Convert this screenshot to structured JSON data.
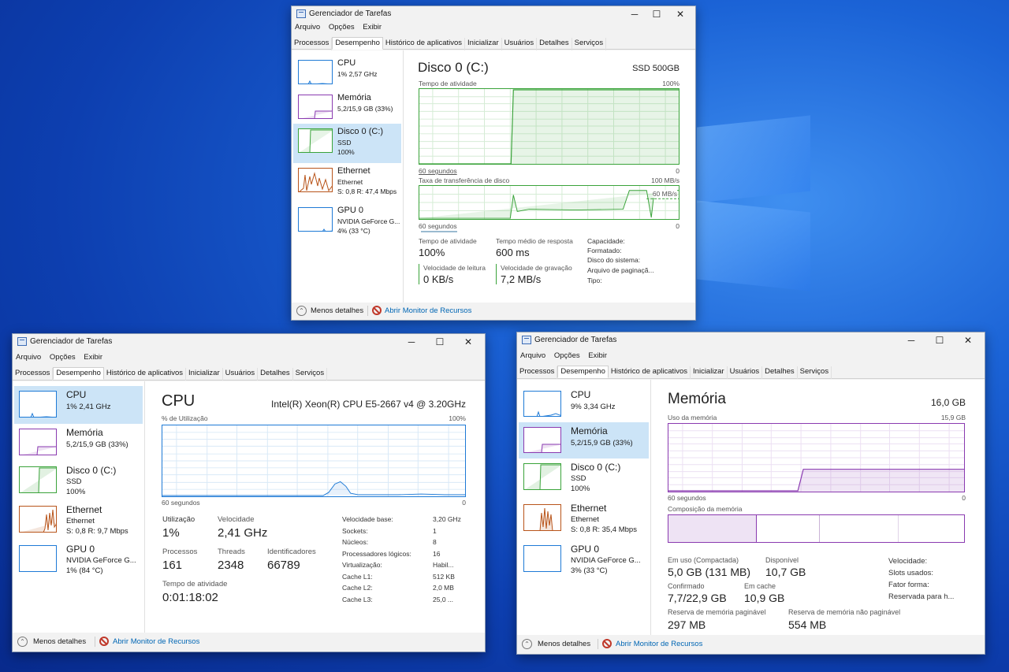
{
  "desktop": {
    "logo": "windows-logo"
  },
  "app": {
    "title": "Gerenciador de Tarefas",
    "menu": [
      "Arquivo",
      "Opções",
      "Exibir"
    ],
    "tabs": [
      "Processos",
      "Desempenho",
      "Histórico de aplicativos",
      "Inicializar",
      "Usuários",
      "Detalhes",
      "Serviços"
    ],
    "active_tab": "Desempenho",
    "footer": {
      "less_details": "Menos detalhes",
      "resource_monitor": "Abrir Monitor de Recursos"
    },
    "window_buttons": [
      "─",
      "☐",
      "✕"
    ]
  },
  "disk_window": {
    "sidebar": [
      {
        "name": "CPU",
        "line1": "1% 2,57 GHz",
        "line2": "",
        "color": "#1e7ad6"
      },
      {
        "name": "Memória",
        "line1": "5,2/15,9 GB (33%)",
        "line2": "",
        "color": "#8a3ab0"
      },
      {
        "name": "Disco 0 (C:)",
        "line1": "SSD",
        "line2": "100%",
        "color": "#3aa33a",
        "selected": true
      },
      {
        "name": "Ethernet",
        "line1": "Ethernet",
        "line2": "S: 0,8 R: 47,4 Mbps",
        "color": "#b8541a"
      },
      {
        "name": "GPU 0",
        "line1": "NVIDIA GeForce G...",
        "line2": "4% (33 °C)",
        "color": "#1e7ad6"
      }
    ],
    "heading": "Disco 0 (C:)",
    "model": "SSD 500GB",
    "activity_label": "Tempo de atividade",
    "activity_max": "100%",
    "axis_left": "60 segundos",
    "axis_right": "0",
    "transfer_label": "Taxa de transferência de disco",
    "transfer_max": "100 MB/s",
    "transfer_mark": "60 MB/s",
    "stats": {
      "active_time_label": "Tempo de atividade",
      "active_time": "100%",
      "avg_response_label": "Tempo médio de resposta",
      "avg_response": "600 ms",
      "read_label": "Velocidade de leitura",
      "read": "0 KB/s",
      "write_label": "Velocidade de gravação",
      "write": "7,2 MB/s"
    },
    "details": [
      "Capacidade:",
      "Formatado:",
      "Disco do sistema:",
      "Arquivo de paginaçã...",
      "Tipo:"
    ]
  },
  "cpu_window": {
    "sidebar": [
      {
        "name": "CPU",
        "line1": "1% 2,41 GHz",
        "line2": "",
        "color": "#1e7ad6",
        "selected": true
      },
      {
        "name": "Memória",
        "line1": "5,2/15,9 GB (33%)",
        "line2": "",
        "color": "#8a3ab0"
      },
      {
        "name": "Disco 0 (C:)",
        "line1": "SSD",
        "line2": "100%",
        "color": "#3aa33a"
      },
      {
        "name": "Ethernet",
        "line1": "Ethernet",
        "line2": "S: 0,8 R: 9,7 Mbps",
        "color": "#b8541a"
      },
      {
        "name": "GPU 0",
        "line1": "NVIDIA GeForce G...",
        "line2": "1% (84 °C)",
        "color": "#1e7ad6"
      }
    ],
    "heading": "CPU",
    "model": "Intel(R) Xeon(R) CPU E5-2667 v4 @ 3.20GHz",
    "util_label": "% de Utilização",
    "util_max": "100%",
    "axis_left": "60 segundos",
    "axis_right": "0",
    "stats": {
      "utilization_label": "Utilização",
      "utilization": "1%",
      "speed_label": "Velocidade",
      "speed": "2,41 GHz",
      "processes_label": "Processos",
      "processes": "161",
      "threads_label": "Threads",
      "threads": "2348",
      "handles_label": "Identificadores",
      "handles": "66789",
      "uptime_label": "Tempo de atividade",
      "uptime": "0:01:18:02"
    },
    "details": [
      [
        "Velocidade base:",
        "3,20 GHz"
      ],
      [
        "Sockets:",
        "1"
      ],
      [
        "Núcleos:",
        "8"
      ],
      [
        "Processadores lógicos:",
        "16"
      ],
      [
        "Virtualização:",
        "Habil..."
      ],
      [
        "Cache L1:",
        "512 KB"
      ],
      [
        "Cache L2:",
        "2,0 MB"
      ],
      [
        "Cache L3:",
        "25,0 ..."
      ]
    ]
  },
  "mem_window": {
    "sidebar": [
      {
        "name": "CPU",
        "line1": "9% 3,34 GHz",
        "line2": "",
        "color": "#1e7ad6"
      },
      {
        "name": "Memória",
        "line1": "5,2/15,9 GB (33%)",
        "line2": "",
        "color": "#8a3ab0",
        "selected": true
      },
      {
        "name": "Disco 0 (C:)",
        "line1": "SSD",
        "line2": "100%",
        "color": "#3aa33a"
      },
      {
        "name": "Ethernet",
        "line1": "Ethernet",
        "line2": "S: 0,8 R: 35,4 Mbps",
        "color": "#b8541a"
      },
      {
        "name": "GPU 0",
        "line1": "NVIDIA GeForce G...",
        "line2": "3% (33 °C)",
        "color": "#1e7ad6"
      }
    ],
    "heading": "Memória",
    "total": "16,0 GB",
    "usage_label": "Uso da memória",
    "usage_max": "15,9 GB",
    "axis_left": "60 segundos",
    "axis_right": "0",
    "composition_label": "Composição da memória",
    "stats": {
      "in_use_label": "Em uso (Compactada)",
      "in_use": "5,0 GB (131 MB)",
      "available_label": "Disponível",
      "available": "10,7 GB",
      "committed_label": "Confirmado",
      "committed": "7,7/22,9 GB",
      "cached_label": "Em cache",
      "cached": "10,9 GB",
      "paged_label": "Reserva de memória paginável",
      "paged": "297 MB",
      "nonpaged_label": "Reserva de memória não paginável",
      "nonpaged": "554 MB"
    },
    "details": [
      "Velocidade:",
      "Slots usados:",
      "Fator forma:",
      "Reservada para h..."
    ]
  }
}
